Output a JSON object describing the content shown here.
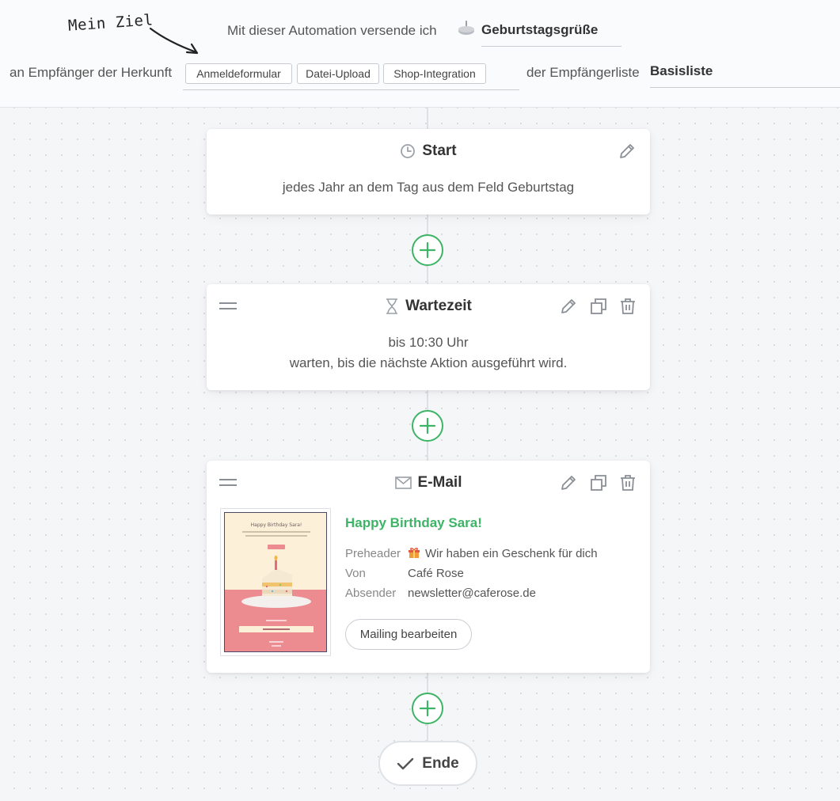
{
  "header": {
    "goal_note": "Mein Ziel",
    "line1_label": "Mit dieser Automation versende ich",
    "line1_value": "Geburtstagsgrüße",
    "line2_label": "an Empfänger der Herkunft",
    "origin_chips": [
      "Anmeldeformular",
      "Datei-Upload",
      "Shop-Integration"
    ],
    "list_label": "der Empfängerliste",
    "list_value": "Basisliste"
  },
  "flow": {
    "start": {
      "title": "Start",
      "description": "jedes Jahr an dem Tag aus dem Feld Geburtstag"
    },
    "wait": {
      "title": "Wartezeit",
      "line1": "bis 10:30 Uhr",
      "line2": "warten, bis die nächste Aktion ausgeführt wird."
    },
    "email": {
      "title": "E-Mail",
      "subject": "Happy Birthday Sara!",
      "preheader_label": "Preheader",
      "preheader_value": "Wir haben ein Geschenk für dich",
      "from_label": "Von",
      "from_value": "Café Rose",
      "sender_label": "Absender",
      "sender_value": "newsletter@caferose.de",
      "edit_button": "Mailing bearbeiten",
      "thumbnail_heading": "Happy Birthday Sara!"
    },
    "end": {
      "label": "Ende"
    }
  },
  "colors": {
    "accent_green": "#3db466",
    "icon_gray": "#8a8f96",
    "thumb_cream": "#fcf1d8",
    "thumb_pink": "#ec8c91",
    "thumb_frame": "#4b4869"
  }
}
